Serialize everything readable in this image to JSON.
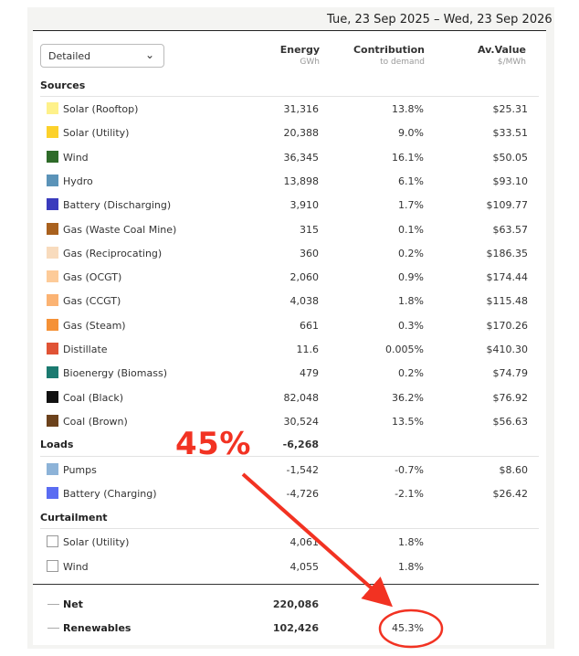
{
  "header": {
    "date_range": "Tue, 23 Sep 2025 – Wed, 23 Sep 2026"
  },
  "view_select": {
    "value": "Detailed",
    "icon": "chevron-down-icon"
  },
  "columns": {
    "energy": {
      "label": "Energy",
      "unit": "GWh"
    },
    "contribution": {
      "label": "Contribution",
      "unit": "to demand"
    },
    "value": {
      "label": "Av.Value",
      "unit": "$/MWh"
    }
  },
  "sections": {
    "sources": "Sources",
    "loads": "Loads",
    "curtailment": "Curtailment"
  },
  "sources": [
    {
      "label": "Solar (Rooftop)",
      "color": "#fef18a",
      "energy": "31,316",
      "contribution": "13.8%",
      "value": "$25.31"
    },
    {
      "label": "Solar (Utility)",
      "color": "#fcd12b",
      "energy": "20,388",
      "contribution": "9.0%",
      "value": "$33.51"
    },
    {
      "label": "Wind",
      "color": "#2e6b29",
      "energy": "36,345",
      "contribution": "16.1%",
      "value": "$50.05"
    },
    {
      "label": "Hydro",
      "color": "#5b93b8",
      "energy": "13,898",
      "contribution": "6.1%",
      "value": "$93.10"
    },
    {
      "label": "Battery (Discharging)",
      "color": "#3a3bbd",
      "energy": "3,910",
      "contribution": "1.7%",
      "value": "$109.77"
    },
    {
      "label": "Gas (Waste Coal Mine)",
      "color": "#a9611e",
      "energy": "315",
      "contribution": "0.1%",
      "value": "$63.57"
    },
    {
      "label": "Gas (Reciprocating)",
      "color": "#f8dbbd",
      "energy": "360",
      "contribution": "0.2%",
      "value": "$186.35"
    },
    {
      "label": "Gas (OCGT)",
      "color": "#fdcb99",
      "energy": "2,060",
      "contribution": "0.9%",
      "value": "$174.44"
    },
    {
      "label": "Gas (CCGT)",
      "color": "#fbb373",
      "energy": "4,038",
      "contribution": "1.8%",
      "value": "$115.48"
    },
    {
      "label": "Gas (Steam)",
      "color": "#f59136",
      "energy": "661",
      "contribution": "0.3%",
      "value": "$170.26"
    },
    {
      "label": "Distillate",
      "color": "#e05335",
      "energy": "11.6",
      "contribution": "0.005%",
      "value": "$410.30"
    },
    {
      "label": "Bioenergy (Biomass)",
      "color": "#1b7a70",
      "energy": "479",
      "contribution": "0.2%",
      "value": "$74.79"
    },
    {
      "label": "Coal (Black)",
      "color": "#111111",
      "energy": "82,048",
      "contribution": "36.2%",
      "value": "$76.92"
    },
    {
      "label": "Coal (Brown)",
      "color": "#6c421c",
      "energy": "30,524",
      "contribution": "13.5%",
      "value": "$56.63"
    }
  ],
  "loads_total": "-6,268",
  "loads": [
    {
      "label": "Pumps",
      "color": "#8db3d8",
      "energy": "-1,542",
      "contribution": "-0.7%",
      "value": "$8.60"
    },
    {
      "label": "Battery (Charging)",
      "color": "#5a6cf2",
      "energy": "-4,726",
      "contribution": "-2.1%",
      "value": "$26.42"
    }
  ],
  "curtailment": [
    {
      "label": "Solar (Utility)",
      "color": "#ffffff",
      "energy": "4,061",
      "contribution": "1.8%",
      "value": ""
    },
    {
      "label": "Wind",
      "color": "#ffffff",
      "energy": "4,055",
      "contribution": "1.8%",
      "value": ""
    }
  ],
  "summary": [
    {
      "label": "Net",
      "energy": "220,086",
      "contribution": ""
    },
    {
      "label": "Renewables",
      "energy": "102,426",
      "contribution": "45.3%"
    }
  ],
  "annotation": {
    "text": "45%",
    "color": "#f23222"
  }
}
